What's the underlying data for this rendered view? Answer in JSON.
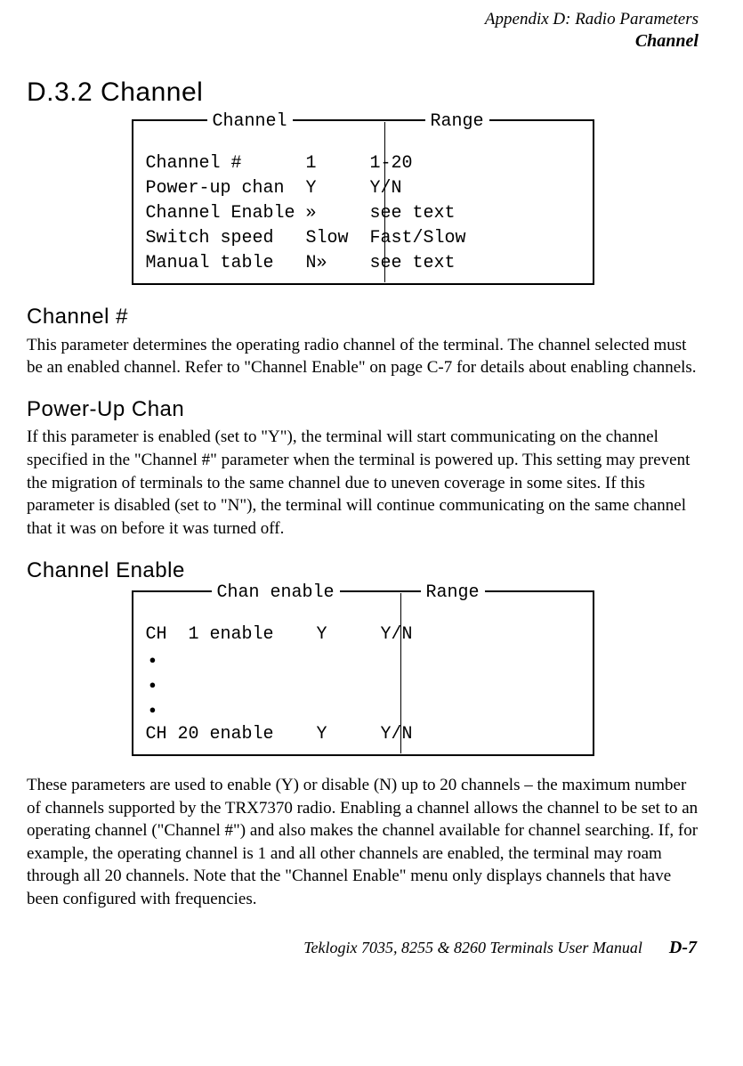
{
  "header": {
    "appendix_line": "Appendix  D:  Radio Parameters",
    "sub_line": "Channel"
  },
  "section_title": "D.3.2   Channel",
  "menu1": {
    "legend_left": "Channel",
    "legend_right": "Range",
    "row1": "Channel #      1     1-20",
    "row2": "Power-up chan  Y     Y/N",
    "row3": "Channel Enable »     see text",
    "row4": "Switch speed   Slow  Fast/Slow",
    "row5": "Manual table   N»    see text"
  },
  "sub1": {
    "heading": "Channel #",
    "text": "This parameter determines the operating radio channel of the terminal. The channel selected must be an enabled channel. Refer to \"Channel Enable\" on page C-7 for details about enabling channels."
  },
  "sub2": {
    "heading": "Power-Up Chan",
    "text": "If this parameter is enabled (set to \"Y\"), the terminal will start communicating on the channel specified in the \"Channel #\" parameter when the terminal is powered up. This setting may prevent the migration of terminals to the same channel due to uneven coverage in some sites. If this parameter is disabled (set to \"N\"), the terminal will continue communicating on the same channel that it was on before it was turned off."
  },
  "sub3": {
    "heading": "Channel Enable"
  },
  "menu2": {
    "legend_left": "Chan enable",
    "legend_right": "Range",
    "row1": "CH  1 enable    Y     Y/N",
    "row5": "CH 20 enable    Y     Y/N"
  },
  "sub3_text": "These parameters are used to enable (Y) or disable (N) up to 20 channels – the maximum number of channels supported by the TRX7370 radio. Enabling a channel allows the channel to be set to an operating channel (\"Channel #\") and also makes the channel available for channel searching. If, for example, the operating channel is 1 and all other channels are enabled, the terminal may roam through all 20 channels. Note that the \"Channel Enable\" menu only displays channels that have been configured with frequencies.",
  "footer": {
    "manual": "Teklogix 7035, 8255 & 8260 Terminals User Manual",
    "pagenum": "D-7"
  }
}
